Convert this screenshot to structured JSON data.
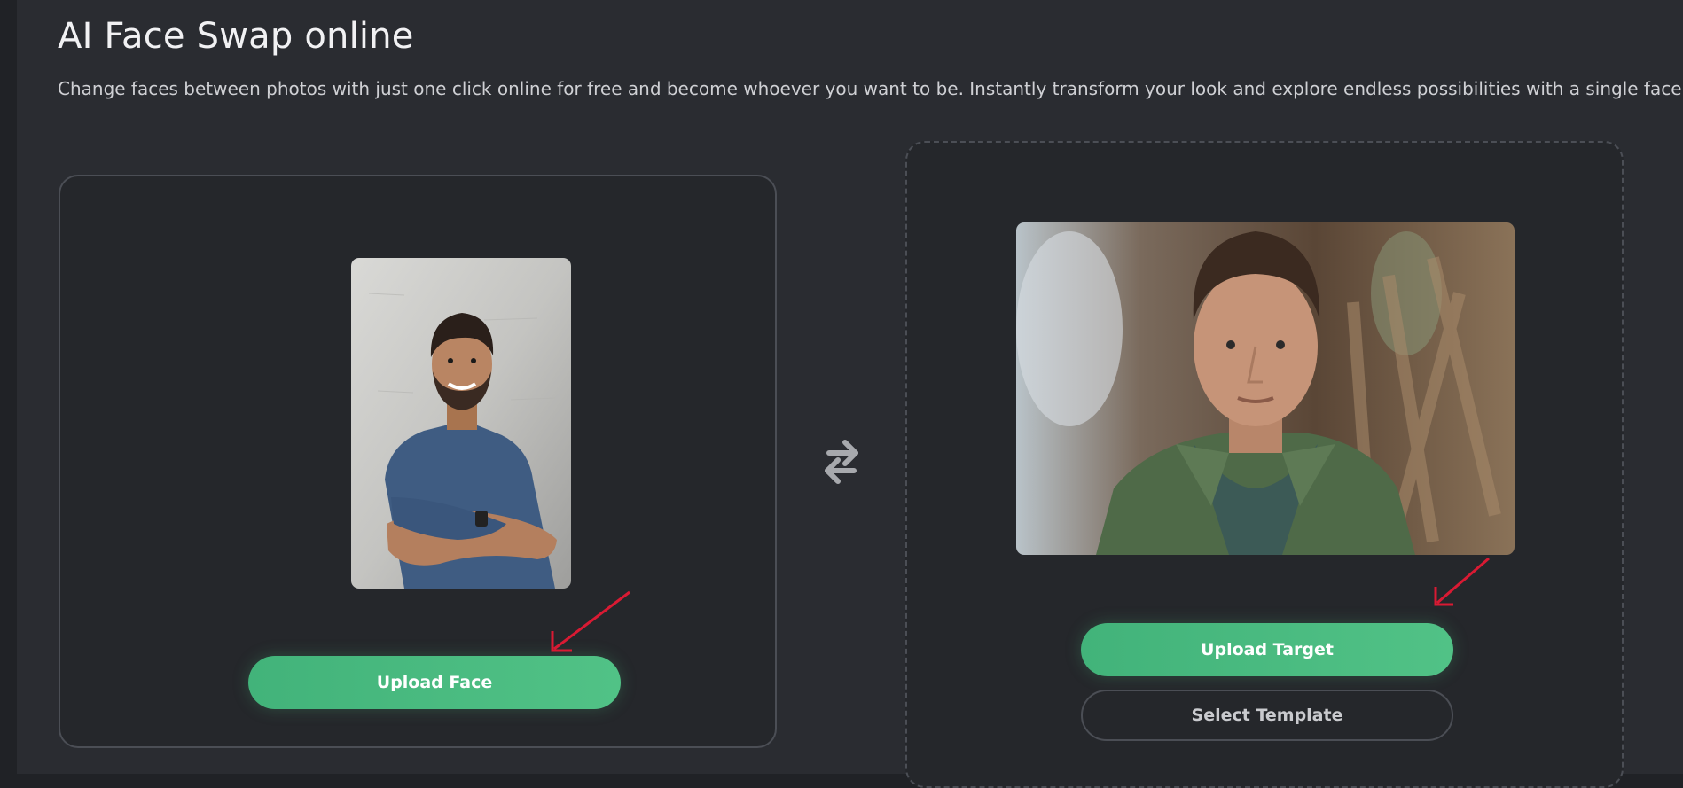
{
  "page": {
    "title": "AI Face Swap online",
    "subtitle": "Change faces between photos with just one click online for free and become whoever you want to be. Instantly transform your look and explore endless possibilities with a single face swap."
  },
  "face_panel": {
    "upload_label": "Upload Face"
  },
  "target_panel": {
    "upload_label": "Upload Target",
    "template_label": "Select Template"
  },
  "icons": {
    "swap": "swap-arrows-icon",
    "annotation": "red-arrow-icon"
  },
  "colors": {
    "accent_green": "#4cbb80",
    "annotation_red": "#d91a33",
    "background": "#2a2c31"
  }
}
